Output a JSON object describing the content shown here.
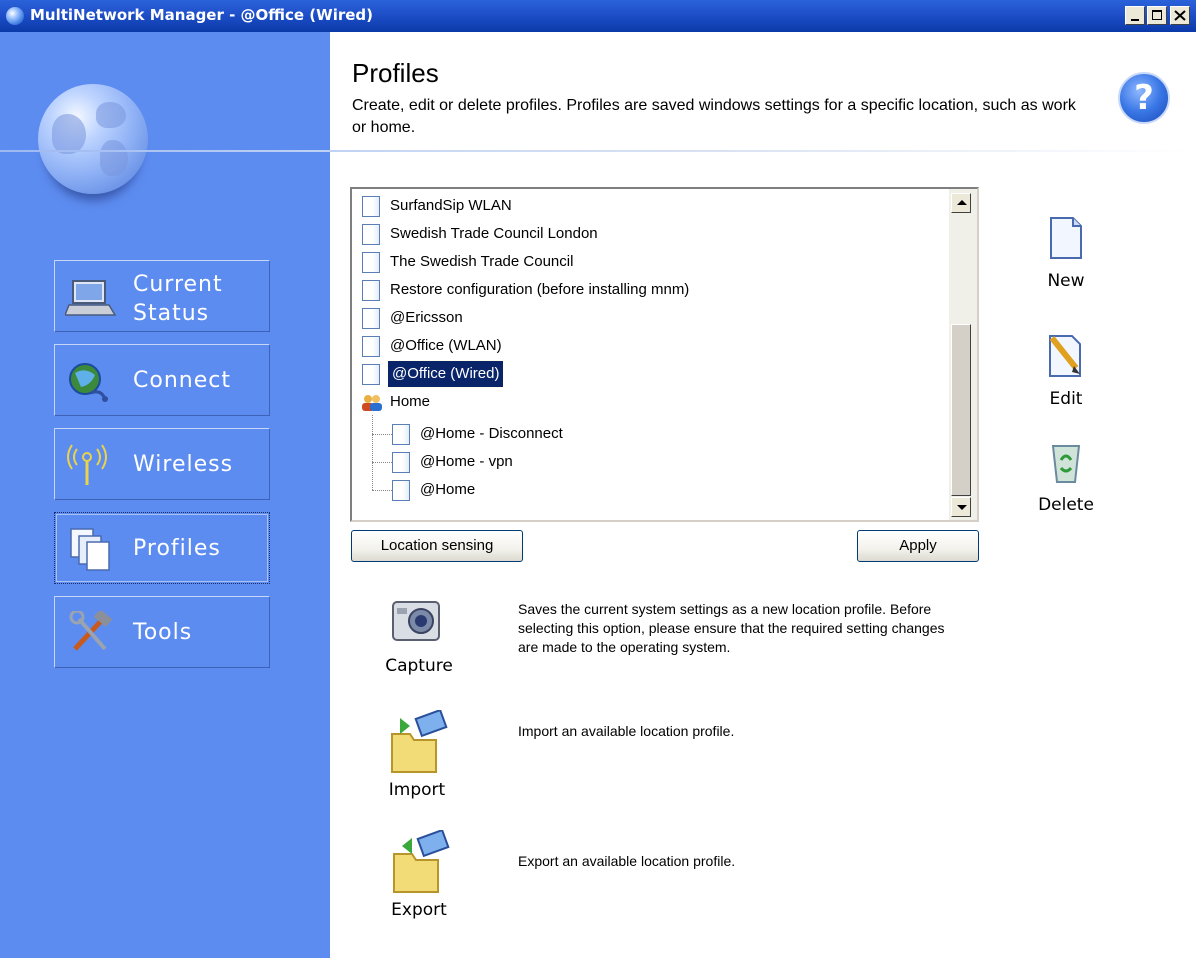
{
  "window": {
    "title": "MultiNetwork Manager - @Office (Wired)"
  },
  "sidebar": {
    "items": [
      {
        "label_line1": "Current",
        "label_line2": "Status",
        "icon": "laptop-icon"
      },
      {
        "label": "Connect",
        "icon": "globe-connect-icon"
      },
      {
        "label": "Wireless",
        "icon": "wireless-antenna-icon"
      },
      {
        "label": "Profiles",
        "icon": "documents-icon",
        "active": true
      },
      {
        "label": "Tools",
        "icon": "tools-icon"
      }
    ]
  },
  "header": {
    "title": "Profiles",
    "description": "Create, edit or delete profiles. Profiles are saved windows settings for a specific location, such as work or home."
  },
  "profiles": {
    "items": [
      {
        "label": "SurfandSip WLAN"
      },
      {
        "label": "Swedish Trade Council London"
      },
      {
        "label": "The Swedish Trade Council"
      },
      {
        "label": "Restore configuration (before installing mnm)"
      },
      {
        "label": "@Ericsson"
      },
      {
        "label": "@Office (WLAN)"
      },
      {
        "label": "@Office (Wired)",
        "selected": true
      },
      {
        "label": "Home",
        "group": true
      },
      {
        "label": "@Home - Disconnect",
        "child": true
      },
      {
        "label": "@Home - vpn",
        "child": true
      },
      {
        "label": "@Home",
        "child": true
      }
    ]
  },
  "buttons": {
    "location_sensing": "Location sensing",
    "apply": "Apply"
  },
  "actions": {
    "new": "New",
    "edit": "Edit",
    "delete": "Delete"
  },
  "features": {
    "capture": {
      "label": "Capture",
      "desc": "Saves the current system settings as a new location profile. Before selecting this option, please ensure that the required setting changes are made to the operating system."
    },
    "import": {
      "label": "Import",
      "desc": "Import an available location profile."
    },
    "export": {
      "label": "Export",
      "desc": "Export an available location profile."
    }
  }
}
